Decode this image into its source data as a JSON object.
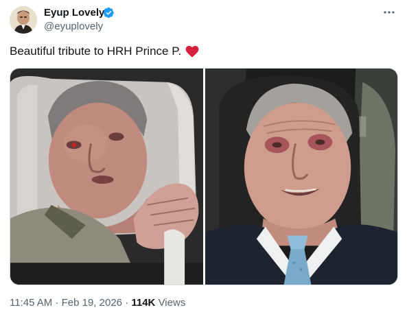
{
  "author": {
    "name": "Eyup Lovely",
    "handle": "@eyuplovely",
    "verified": true
  },
  "tweet": {
    "text": "Beautiful tribute to HRH Prince P.",
    "emoji": "heart-icon"
  },
  "meta": {
    "time": "11:45 AM",
    "separator1": " · ",
    "date": "Feb 19, 2026",
    "separator2": " · ",
    "views_count": "114K",
    "views_label": " Views"
  },
  "colors": {
    "text": "#0f1419",
    "secondary": "#536471",
    "verified": "#1d9bf0",
    "heart": "#d61f3c",
    "border": "#cfd9de"
  },
  "icons": [
    "verified-badge-icon",
    "more-options-icon",
    "heart-icon"
  ]
}
